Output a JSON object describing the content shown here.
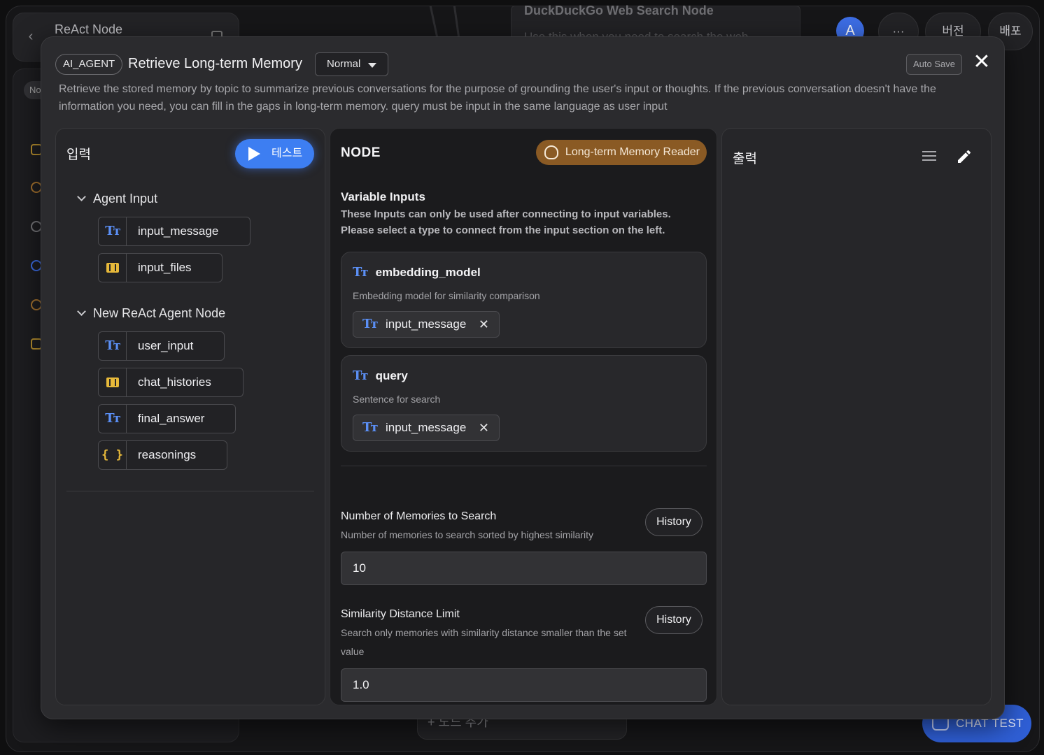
{
  "background": {
    "app_title": "ReAct Node",
    "side_tab": "No",
    "canvas_node_title": "DuckDuckGo Web Search Node",
    "canvas_node_desc": "Use this when you need to search the web",
    "avatar_letter": "A",
    "more_label": "···",
    "version_label": "버전",
    "deploy_label": "배포",
    "add_node_label": "+ 노드 추가",
    "chat_test_label": "CHAT TEST"
  },
  "modal": {
    "type_badge": "AI_AGENT",
    "title": "Retrieve Long-term Memory",
    "mode": "Normal",
    "auto_save": "Auto Save",
    "close_glyph": "✕",
    "description": "Retrieve the stored memory by topic to summarize previous conversations for the purpose of grounding the user's input or thoughts. If the previous conversation doesn't have the information you need, you can fill in the gaps in long-term memory. query must be input in the same language as user input"
  },
  "input_panel": {
    "heading": "입력",
    "test_button": "테스트",
    "groups": [
      {
        "name": "Agent Input",
        "items": [
          {
            "label": "input_message",
            "icon": "text-type-icon"
          },
          {
            "label": "input_files",
            "icon": "array-icon"
          }
        ]
      },
      {
        "name": "New ReAct Agent Node",
        "items": [
          {
            "label": "user_input",
            "icon": "text-type-icon"
          },
          {
            "label": "chat_histories",
            "icon": "array-icon"
          },
          {
            "label": "final_answer",
            "icon": "text-type-icon"
          },
          {
            "label": "reasonings",
            "icon": "object-icon"
          }
        ]
      }
    ]
  },
  "node_panel": {
    "heading": "NODE",
    "badge": "Long-term Memory Reader",
    "variable_inputs_title": "Variable Inputs",
    "variable_inputs_sub": "These Inputs can only be used after connecting to input variables. Please select a type to connect from the input section on the left.",
    "variables": [
      {
        "name": "embedding_model",
        "desc": "Embedding model for similarity comparison",
        "bound": "input_message"
      },
      {
        "name": "query",
        "desc": "Sentence for search",
        "bound": "input_message"
      }
    ],
    "fields": [
      {
        "label": "Number of Memories to Search",
        "help": "Number of memories to search sorted by highest similarity",
        "value": "10",
        "history": "History"
      },
      {
        "label": "Similarity Distance Limit",
        "help": "Search only memories with similarity distance smaller than the set value",
        "value": "1.0",
        "history": "History"
      }
    ]
  },
  "output_panel": {
    "heading": "출력"
  },
  "glyphs": {
    "text_type": "Tт",
    "object": "{ }",
    "remove": "✕"
  },
  "colors": {
    "accent_blue": "#3d7ef2",
    "badge_brown": "#8a5a24",
    "type_text_blue": "#5b8ff5",
    "type_array_yellow": "#e7b93a"
  }
}
